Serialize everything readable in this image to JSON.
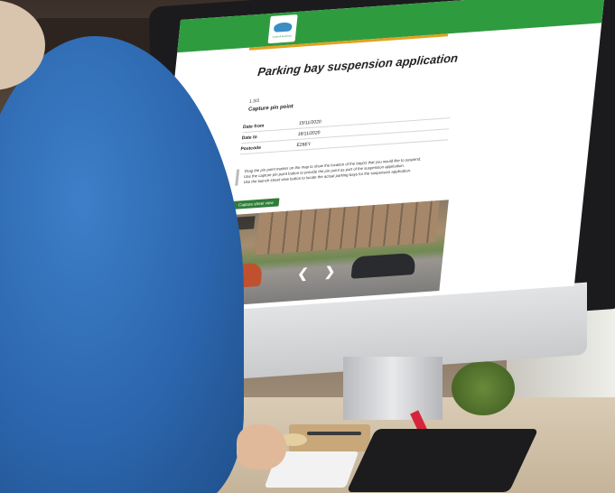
{
  "page": {
    "title": "Parking bay suspension application",
    "step": "1.3/3",
    "subtitle": "Capture pin point",
    "details": [
      {
        "label": "Date from",
        "value": "15/11/2020"
      },
      {
        "label": "Date to",
        "value": "16/11/2020"
      },
      {
        "label": "Postcode",
        "value": "E26EY"
      }
    ],
    "instructions": [
      "Drag the pin point marker on the map to show the location of the bay(s) that you would like to suspend.",
      "Use the capture pin point button to provide the pin point as part of the suspension application.",
      "Use the launch street view button to locate the actual parking bays for the suspension application."
    ],
    "capture_button": "Capture street view",
    "logo_text": "council services"
  },
  "colors": {
    "header": "#2f9b3f",
    "accent": "#e0a321",
    "button": "#2f7d3a"
  },
  "icons": {
    "prev": "chevron-left-icon",
    "next": "chevron-right-icon"
  }
}
